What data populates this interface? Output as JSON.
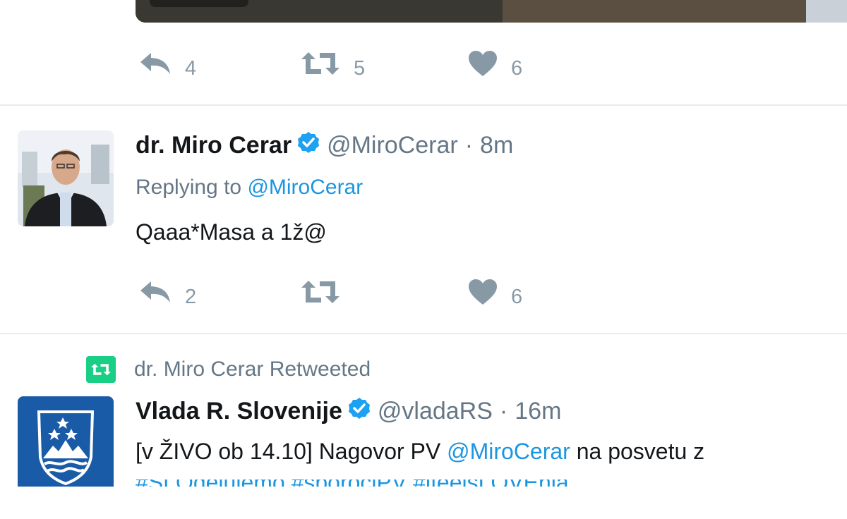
{
  "tweets": [
    {
      "actions": {
        "reply_count": "4",
        "retweet_count": "5",
        "like_count": "6"
      }
    },
    {
      "author": {
        "name": "dr. Miro Cerar",
        "handle": "@MiroCerar",
        "time": "8m",
        "verified": true
      },
      "replying_prefix": "Replying to",
      "replying_to": "@MiroCerar",
      "text": "Qaaa*Masa a 1ž@",
      "actions": {
        "reply_count": "2",
        "retweet_count": "",
        "like_count": "6"
      }
    },
    {
      "retweeted_by": "dr. Miro Cerar Retweeted",
      "author": {
        "name": "Vlada R. Slovenije",
        "handle": "@vladaRS",
        "time": "16m",
        "verified": true
      },
      "text_prefix": "[v ŽIVO ob 14.10] Nagovor PV",
      "text_mention": "@MiroCerar",
      "text_suffix": "na posvetu z",
      "text_next_line": "#SLOdelujemo #sporočiPV #ifeelsLOVEnia"
    }
  ],
  "icons": {
    "reply": "reply-icon",
    "retweet": "retweet-icon",
    "like": "heart-icon",
    "verified": "verified-badge-icon"
  },
  "colors": {
    "text": "#14171a",
    "secondary": "#657786",
    "action": "#8899a6",
    "link": "#1b95e0",
    "verified": "#1da1f2",
    "retweet_green": "#19cf86",
    "coat_of_arms_blue": "#1a5ba8"
  }
}
